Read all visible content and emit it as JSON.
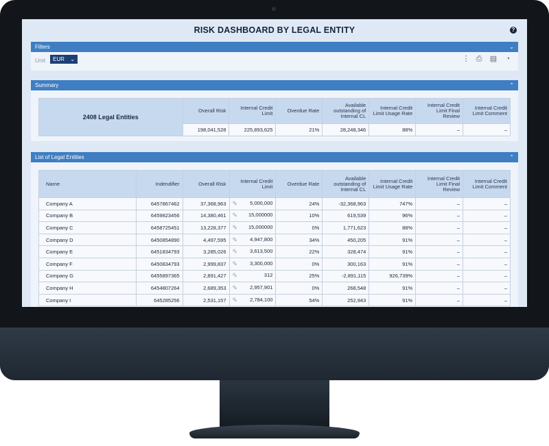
{
  "dashboard": {
    "title": "RISK DASHBOARD BY LEGAL ENTITY",
    "help_icon": "question-icon"
  },
  "filters": {
    "header": "Filters",
    "unit_label": "Unit",
    "unit_value": "EUR",
    "tools": [
      "more-vert-icon",
      "print-icon",
      "export-icon",
      "chart-icon"
    ]
  },
  "summary": {
    "header": "Summary",
    "entities_label": "2408 Legal Entities",
    "columns": [
      "Overall Risk",
      "Internal Credit Limit",
      "Overdue Rate",
      "Available outstanding of Internal CL",
      "Internal Credit Limit Usage Rate",
      "Internal Credit Limit Final Review",
      "Internal Credit Limit Comment"
    ],
    "values": [
      "198,041,528",
      "225,893,625",
      "21%",
      "28,248,346",
      "88%",
      "–",
      "–"
    ]
  },
  "list": {
    "header": "List of Legal Entities",
    "columns": [
      "Name",
      "Indendifier",
      "Overall Risk",
      "Internal Credit Limit",
      "Overdue Rate",
      "Available outstanding of Internal CL",
      "Internal Credit Limit Usage Rate",
      "Internal Credit Limit Final Review",
      "Internal Credit Limit Comment"
    ],
    "rows": [
      [
        "Company A",
        "6457867462",
        "37,368,963",
        "5,000,000",
        "24%",
        "-32,368,963",
        "747%",
        "–",
        "–"
      ],
      [
        "Company B",
        "6459823456",
        "14,380,461",
        "15,000000",
        "10%",
        "619,539",
        "96%",
        "–",
        "–"
      ],
      [
        "Company C",
        "6458725451",
        "13,228,377",
        "15,000000",
        "0%",
        "1,771,623",
        "88%",
        "–",
        "–"
      ],
      [
        "Company D",
        "6450854890",
        "4,497,595",
        "4,947,800",
        "34%",
        "450,205",
        "91%",
        "–",
        "–"
      ],
      [
        "Company E",
        "6451834793",
        "3,285,026",
        "3,613,500",
        "22%",
        "328,474",
        "91%",
        "–",
        "–"
      ],
      [
        "Company F",
        "6450834793",
        "2,999,837",
        "3,300,000",
        "0%",
        "300,163",
        "91%",
        "–",
        "–"
      ],
      [
        "Company G",
        "6455897365",
        "2,891,427",
        "312",
        "25%",
        "-2,891,115",
        "926,739%",
        "–",
        "–"
      ],
      [
        "Company H",
        "6454807264",
        "2,689,353",
        "2,957,901",
        "0%",
        "268,548",
        "91%",
        "–",
        "–"
      ],
      [
        "Company  I",
        "645285256",
        "2,531,157",
        "2,784,100",
        "54%",
        "252,943",
        "91%",
        "–",
        "–"
      ]
    ]
  }
}
